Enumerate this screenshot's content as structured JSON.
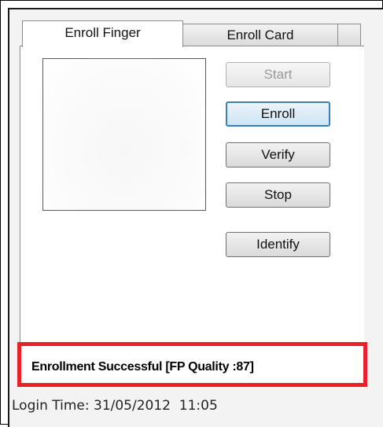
{
  "tabs": [
    {
      "label": "Enroll Finger",
      "active": true
    },
    {
      "label": "Enroll Card",
      "active": false
    }
  ],
  "buttons": {
    "start": "Start",
    "enroll": "Enroll",
    "verify": "Verify",
    "stop": "Stop",
    "identify": "Identify"
  },
  "status": {
    "message": "Enrollment Successful [FP Quality :87]",
    "highlight_color": "#e8202a"
  },
  "footer": {
    "login_time": "Login Time: 31/05/2012  11:05"
  }
}
